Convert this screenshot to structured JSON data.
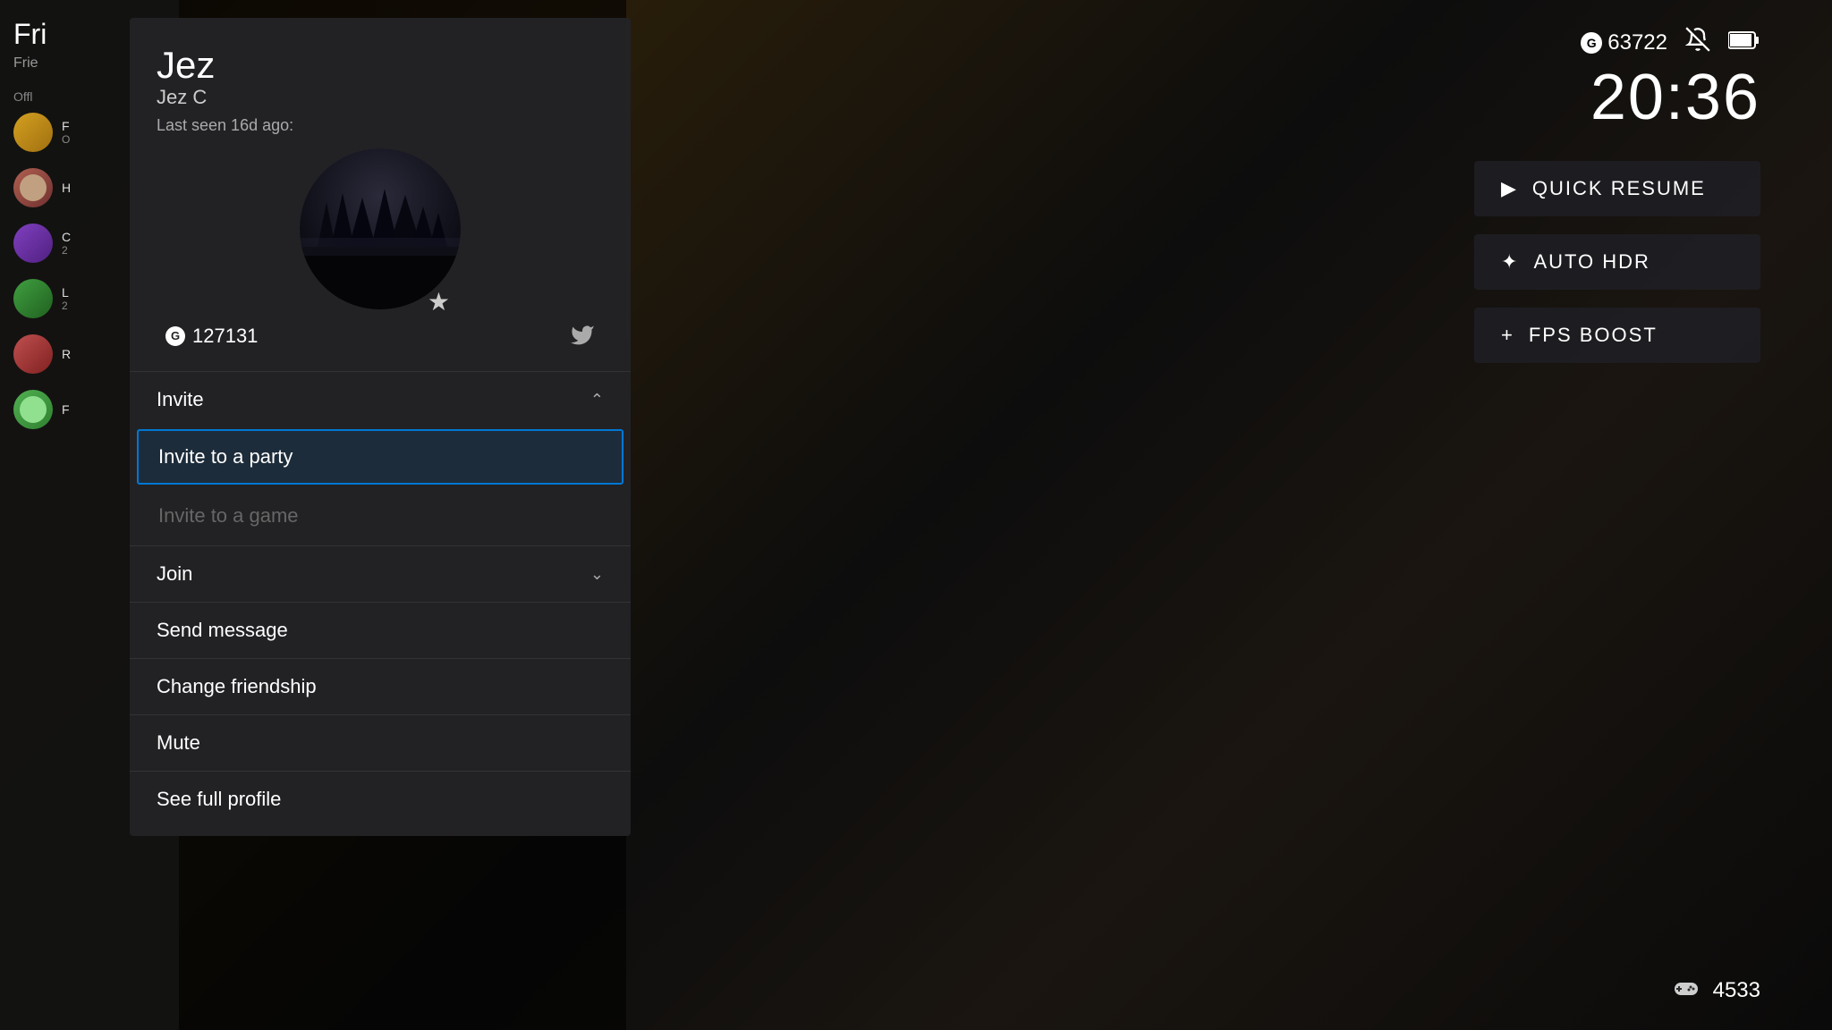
{
  "background": {
    "color": "#1a1208"
  },
  "friends_panel": {
    "title": "Fri",
    "subtitle": "Frie",
    "offline_label": "Offl",
    "friends": [
      {
        "name": "F",
        "status": "O",
        "avatar_color": "yellow",
        "game": ""
      },
      {
        "name": "H",
        "status": "",
        "avatar_color": "red",
        "game": ""
      },
      {
        "name": "C",
        "status": "2",
        "avatar_color": "purple",
        "game": ""
      },
      {
        "name": "L",
        "status": "2",
        "avatar_color": "green",
        "game": ""
      },
      {
        "name": "R",
        "status": "",
        "avatar_color": "red",
        "game": ""
      },
      {
        "name": "F",
        "status": "",
        "avatar_color": "blue",
        "game": ""
      }
    ]
  },
  "profile": {
    "name": "Jez",
    "gamertag": "Jez C",
    "last_seen": "Last seen 16d ago:",
    "gamerscore": "127131",
    "gamerscore_prefix": "G",
    "star": "★",
    "twitter_icon": "🐦"
  },
  "menu": {
    "invite_header": "Invite",
    "invite_to_party": "Invite to a party",
    "invite_to_game": "Invite to a game",
    "join_header": "Join",
    "send_message": "Send message",
    "change_friendship": "Change friendship",
    "mute": "Mute",
    "see_full_profile": "See full profile"
  },
  "hud": {
    "gamerscore": "63722",
    "gamerscore_prefix": "G",
    "time": "20:36",
    "controller_number": "4533"
  },
  "quick_actions": {
    "quick_resume": "QUICK RESUME",
    "auto_hdr": "AUTO HDR",
    "fps_boost": "FPS BOOST"
  }
}
